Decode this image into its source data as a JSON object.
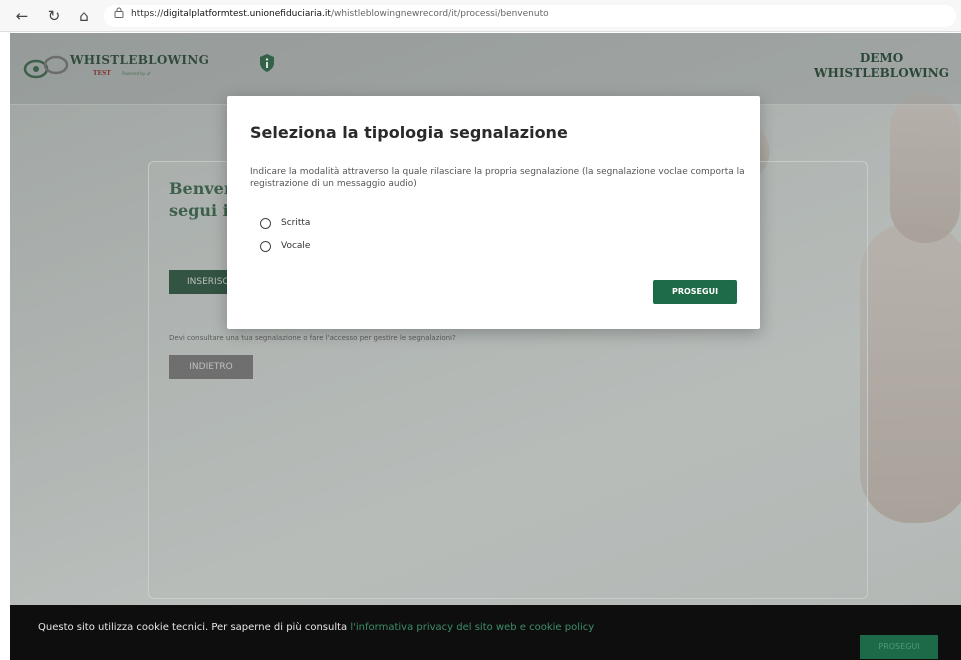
{
  "browser": {
    "back_icon": "←",
    "reload_icon": "↻",
    "home_icon": "⌂",
    "lock_icon": "🔒",
    "url_prefix": "https://",
    "url_host": "digitalplatformtest.unionefiduciaria.it",
    "url_path": "/whistleblowingnewrecord/it/processi/benvenuto"
  },
  "header": {
    "logo_title": "WHISTLEBLOWING",
    "logo_sub": "TEST",
    "logo_powered": "Powered by uf",
    "demo_title_line1": "DEMO",
    "demo_title_line2": "WHISTLEBLOWING"
  },
  "card": {
    "welcome_line1": "Benven",
    "welcome_line2": "segui i v",
    "inserisci_label": "INSERISC",
    "consult_text": "Devi consultare una tua segnalazione o fare l'accesso per gestire le segnalazioni?",
    "indietro_label": "INDIETRO"
  },
  "modal": {
    "title": "Seleziona la tipologia segnalazione",
    "description": "Indicare la modalità attraverso la quale rilasciare la propria segnalazione (la segnalazione voclae comporta la registrazione di un messaggio audio)",
    "options": [
      {
        "label": "Scritta",
        "selected": false
      },
      {
        "label": "Vocale",
        "selected": false
      }
    ],
    "proceed_label": "PROSEGUI"
  },
  "cookie": {
    "text": "Questo sito utilizza cookie tecnici. Per saperne di più consulta ",
    "link": "l'informativa privacy del sito web e cookie policy",
    "button_label": "PROSEGUI"
  },
  "colors": {
    "accent": "#1e6b47",
    "brand_dark": "#143826",
    "cookie_bg": "#0e0e0e"
  }
}
